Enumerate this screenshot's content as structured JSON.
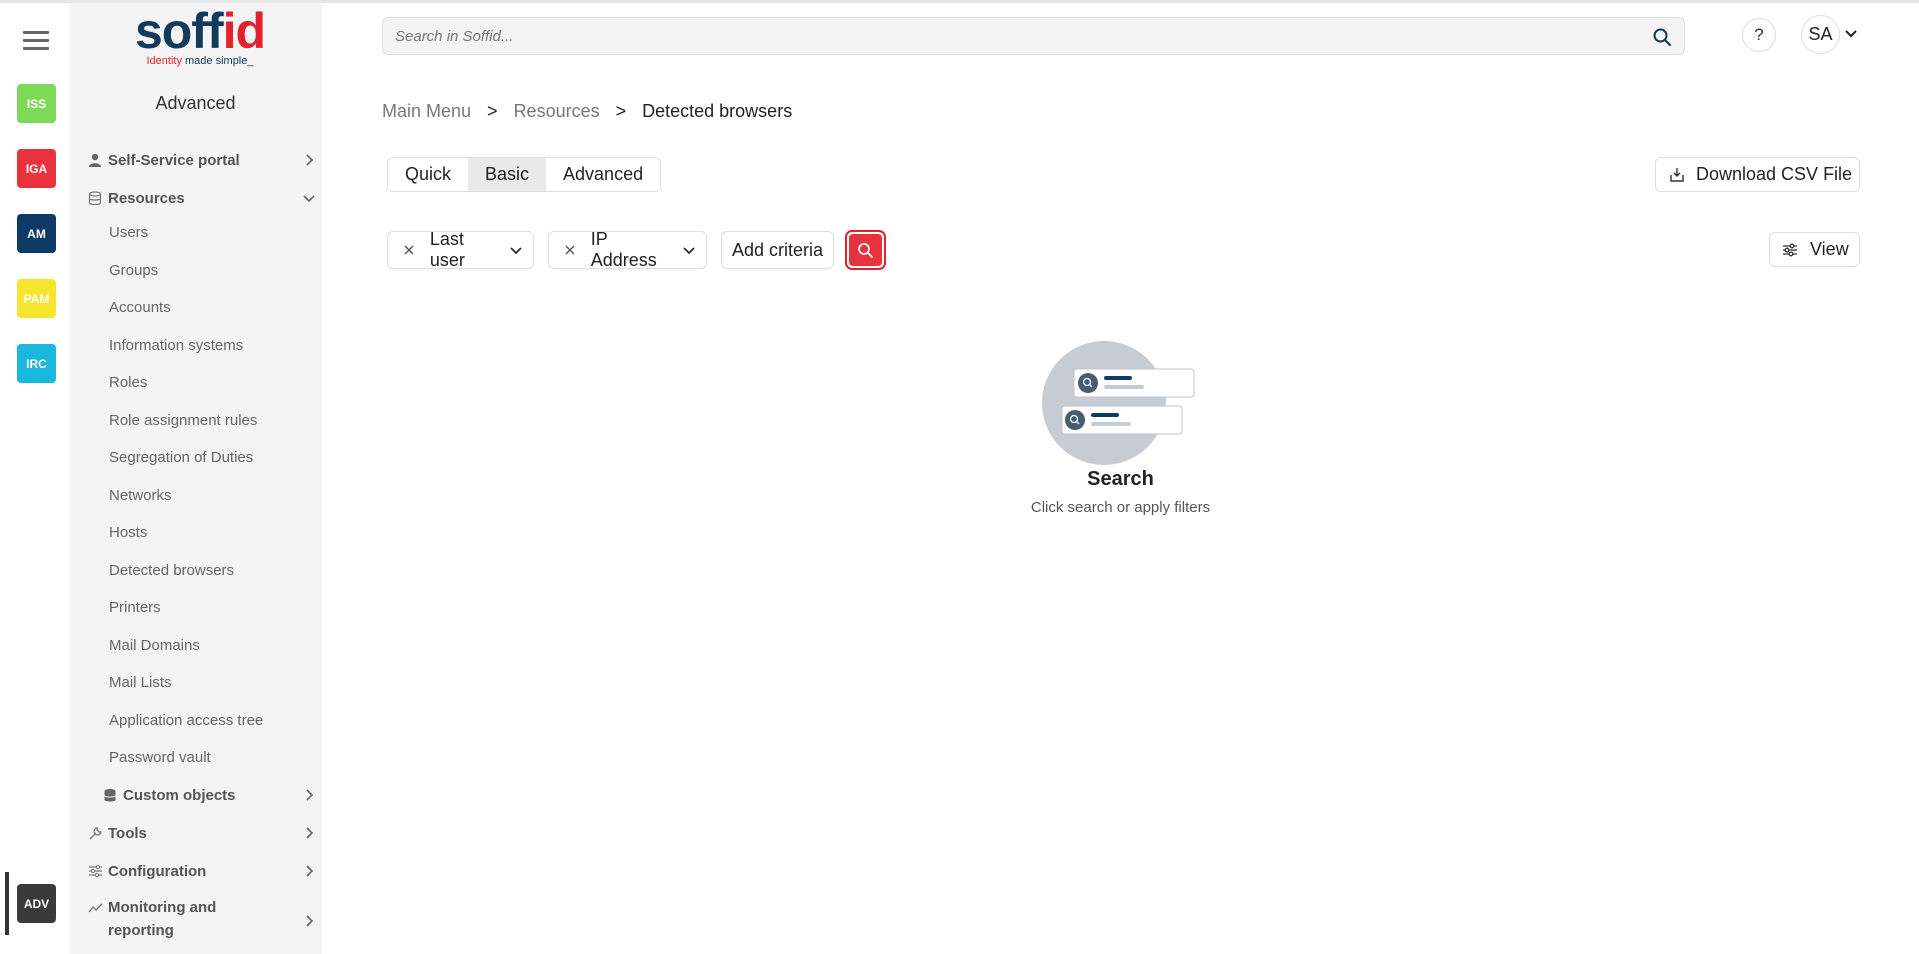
{
  "rail": {
    "apps": [
      {
        "label": "ISS",
        "color": "#7ed957"
      },
      {
        "label": "IGA",
        "color": "#e8333f"
      },
      {
        "label": "AM",
        "color": "#0d3b66"
      },
      {
        "label": "PAM",
        "color": "#f5e52c"
      },
      {
        "label": "IRC",
        "color": "#1ab8dc"
      },
      {
        "label": "ADV",
        "color": "#3a3a3a"
      }
    ]
  },
  "logo": {
    "word_part1": "soff",
    "word_part2": "id",
    "tagline_part1": "Identity",
    "tagline_part2": " made simple_"
  },
  "sidebar": {
    "heading": "Advanced",
    "sections": {
      "self_service": "Self-Service portal",
      "resources": "Resources",
      "custom_objects": "Custom objects",
      "tools": "Tools",
      "configuration": "Configuration",
      "monitoring": "Monitoring and reporting"
    },
    "items": [
      "Users",
      "Groups",
      "Accounts",
      "Information systems",
      "Roles",
      "Role assignment rules",
      "Segregation of Duties",
      "Networks",
      "Hosts",
      "Detected browsers",
      "Printers",
      "Mail Domains",
      "Mail Lists",
      "Application access tree",
      "Password vault"
    ]
  },
  "header": {
    "search_placeholder": "Search in Soffid...",
    "help_label": "?",
    "avatar_initials": "SA"
  },
  "breadcrumb": {
    "main": "Main Menu",
    "resources": "Resources",
    "current": "Detected browsers",
    "separator": ">"
  },
  "mode_tabs": [
    "Quick",
    "Basic",
    "Advanced"
  ],
  "toolbar": {
    "download_csv": "Download CSV File",
    "view": "View"
  },
  "filters": {
    "chips": [
      "Last user",
      "IP Address"
    ],
    "add_criteria": "Add criteria"
  },
  "empty_state": {
    "title": "Search",
    "subtitle": "Click search or apply filters"
  },
  "colors": {
    "accent": "#e3212d",
    "brand_navy": "#123a5c",
    "sidebar_bg": "#f4f4f4"
  }
}
